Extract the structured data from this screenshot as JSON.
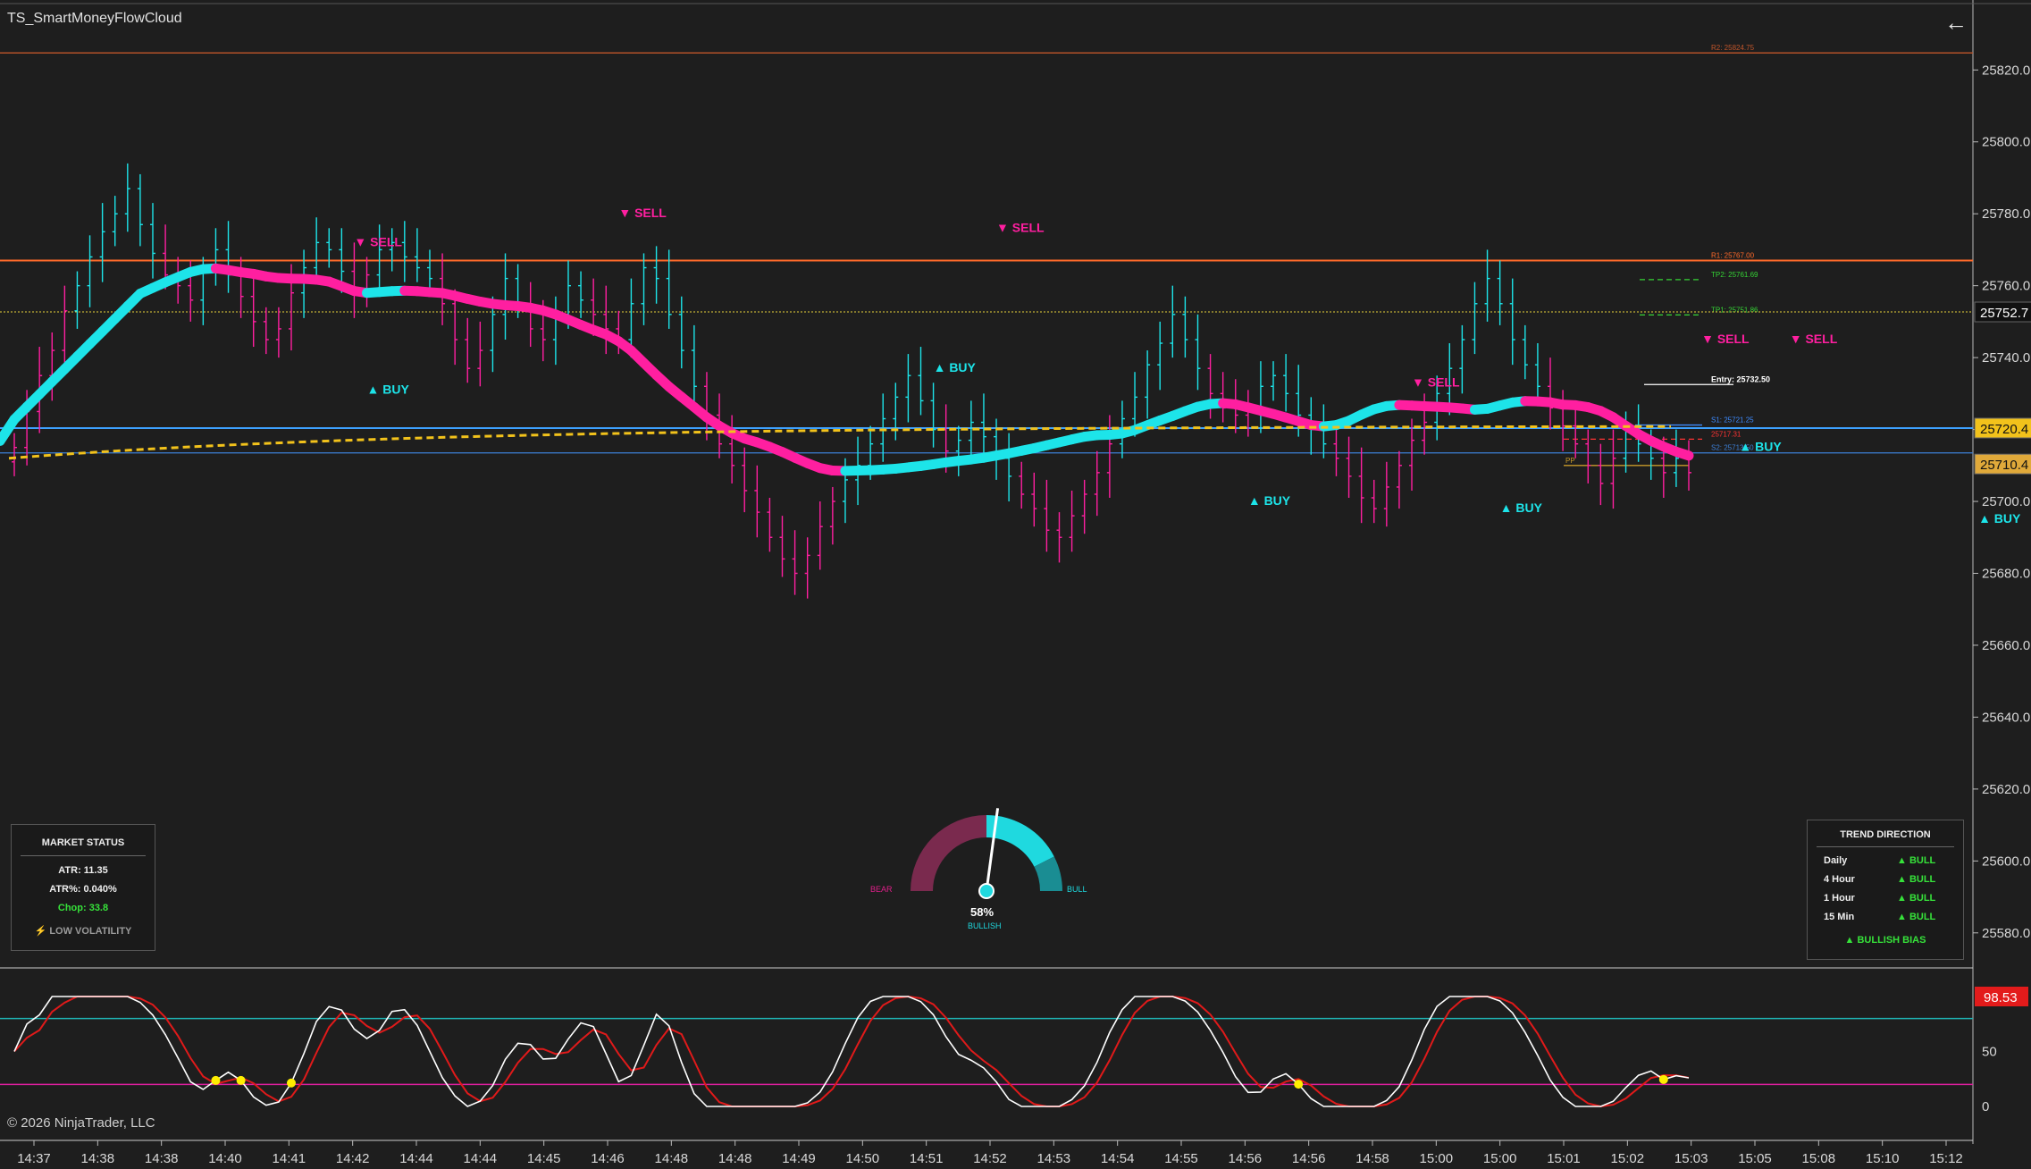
{
  "app": {
    "title": "TS_SmartMoneyFlowCloud",
    "copyright": "© 2026 NinjaTrader, LLC"
  },
  "price_axis": {
    "ticks": [
      "25820.0",
      "25800.0",
      "25780.0",
      "25760.0",
      "25740.0",
      "25720.0",
      "25700.0",
      "25680.0",
      "25660.0",
      "25640.0",
      "25620.0",
      "25600.0",
      "25580.0"
    ]
  },
  "price_tags": [
    {
      "label": "25752.7",
      "value": 25752.7,
      "color": "#ffffff",
      "bg": "#111111"
    },
    {
      "label": "25720.4",
      "value": 25720.4,
      "color": "#111111",
      "bg": "#f2c21b"
    },
    {
      "label": "25710.4",
      "value": 25710.4,
      "color": "#111111",
      "bg": "#e0a93a"
    }
  ],
  "time_axis": {
    "ticks": [
      "14:37",
      "14:38",
      "14:38",
      "14:40",
      "14:41",
      "14:42",
      "14:44",
      "14:44",
      "14:45",
      "14:46",
      "14:48",
      "14:48",
      "14:49",
      "14:50",
      "14:51",
      "14:52",
      "14:53",
      "14:54",
      "14:55",
      "14:56",
      "14:56",
      "14:58",
      "15:00",
      "15:00",
      "15:01",
      "15:02",
      "15:03",
      "15:05",
      "15:08",
      "15:10",
      "15:12"
    ]
  },
  "levels": [
    {
      "label": "R2: 25824.75",
      "value": 25824.75,
      "color": "#c0552a",
      "style": "solid"
    },
    {
      "label": "R1: 25767.00",
      "value": 25767.0,
      "color": "#ff6a2a",
      "style": "solid"
    },
    {
      "label": "TP2: 25761.69",
      "value": 25761.69,
      "color": "#35d435",
      "style": "dash"
    },
    {
      "label": "TP1: 25751.86",
      "value": 25751.86,
      "color": "#35d435",
      "style": "dash"
    },
    {
      "label": "Entry: 25732.50",
      "value": 25732.5,
      "color": "#ffffff",
      "style": "solid"
    },
    {
      "label": "S1: 25721.25",
      "value": 25721.25,
      "color": "#3d8bff",
      "style": "solid"
    },
    {
      "label": "25717.31",
      "value": 25717.31,
      "color": "#ff3333",
      "style": "dash"
    },
    {
      "label": "S2: 25713.50",
      "value": 25713.5,
      "color": "#3d7fd6",
      "style": "solid"
    },
    {
      "label": "PP",
      "value": 25710.0,
      "color": "#c79a2a",
      "style": "solid"
    }
  ],
  "signals": [
    {
      "text": "▼ SELL",
      "type": "sell",
      "bar": 27,
      "price": 25771
    },
    {
      "text": "▲ BUY",
      "type": "buy",
      "bar": 28,
      "price": 25730
    },
    {
      "text": "▼ SELL",
      "type": "sell",
      "bar": 48,
      "price": 25779
    },
    {
      "text": "▼ SELL",
      "type": "sell",
      "bar": 78,
      "price": 25775
    },
    {
      "text": "▲ BUY",
      "type": "buy",
      "bar": 73,
      "price": 25736
    },
    {
      "text": "▼ SELL",
      "type": "sell",
      "bar": 111,
      "price": 25732
    },
    {
      "text": "▲ BUY",
      "type": "buy",
      "bar": 98,
      "price": 25699
    },
    {
      "text": "▲ BUY",
      "type": "buy",
      "bar": 118,
      "price": 25697
    },
    {
      "text": "▼ SELL",
      "type": "sell",
      "bar": 134,
      "price": 25744
    },
    {
      "text": "▼ SELL",
      "type": "sell",
      "bar": 141,
      "price": 25744
    },
    {
      "text": "▲ BUY",
      "type": "buy",
      "bar": 137,
      "price": 25714
    },
    {
      "text": "▲ BUY",
      "type": "buy",
      "bar": 156,
      "price": 25694
    },
    {
      "text": "▼ SELL",
      "type": "sell",
      "bar": 168,
      "price": 25744
    },
    {
      "text": "▲ BUY",
      "type": "buy",
      "bar": 186,
      "price": 25706
    }
  ],
  "market_status": {
    "title": "MARKET STATUS",
    "atr": "ATR: 11.35",
    "atr_pct": "ATR%: 0.040%",
    "chop": "Chop: 33.8",
    "volatility": "⚡ LOW VOLATILITY"
  },
  "trend_direction": {
    "title": "TREND DIRECTION",
    "rows": [
      {
        "tf": "Daily",
        "val": "▲ BULL"
      },
      {
        "tf": "4 Hour",
        "val": "▲ BULL"
      },
      {
        "tf": "1 Hour",
        "val": "▲ BULL"
      },
      {
        "tf": "15 Min",
        "val": "▲ BULL"
      }
    ],
    "bias": "▲ BULLISH BIAS"
  },
  "gauge": {
    "percent": 58,
    "percent_label": "58%",
    "status": "BULLISH",
    "bear_label": "BEAR",
    "bull_label": "BULL"
  },
  "oscillator": {
    "ticks": [
      "50",
      "0"
    ],
    "value_label": "98.53",
    "upper": 80,
    "lower": 20
  },
  "colors": {
    "bull": "#1de4e9",
    "bear": "#ff1fa0",
    "background": "#1e1e1e"
  },
  "chart_data": {
    "type": "line",
    "title": "TS_SmartMoneyFlowCloud",
    "ylim": [
      25571,
      25832
    ],
    "series": [
      {
        "values": [
          25715,
          25725,
          25735,
          25742,
          25753,
          25760,
          25768,
          25775,
          25780,
          25787,
          25777,
          25769,
          25763,
          25760,
          25756,
          25764,
          25770,
          25763,
          25757,
          25750,
          25745,
          25748,
          25758,
          25765,
          25772,
          25770,
          25764,
          25758,
          25763,
          25770,
          25772,
          25768,
          25765,
          25762,
          25755,
          25745,
          25737,
          25742,
          25752,
          25762,
          25755,
          25748,
          25745,
          25752,
          25760,
          25756,
          25752,
          25748,
          25745,
          25755,
          25765,
          25762,
          25752,
          25742,
          25732,
          25724,
          25716,
          25710,
          25703,
          25697,
          25690,
          25684,
          25680,
          25685,
          25693,
          25700,
          25706,
          25710,
          25716,
          25723,
          25729,
          25735,
          25728,
          25720,
          25714,
          25717,
          25722,
          25718,
          25712,
          25707,
          25702,
          25698,
          25692,
          25690,
          25696,
          25702,
          25708,
          25716,
          25723,
          25729,
          25738,
          25744,
          25752,
          25745,
          25737,
          25730,
          25726,
          25724,
          25726,
          25732,
          25735,
          25730,
          25724,
          25720,
          25716,
          25712,
          25707,
          25701,
          25698,
          25704,
          25710,
          25717,
          25722,
          25730,
          25737,
          25745,
          25755,
          25762,
          25755,
          25745,
          25738,
          25732,
          25726,
          25721,
          25716,
          25710,
          25705,
          25712,
          25720,
          25716,
          25712,
          25708,
          25712,
          25708
        ]
      }
    ]
  }
}
